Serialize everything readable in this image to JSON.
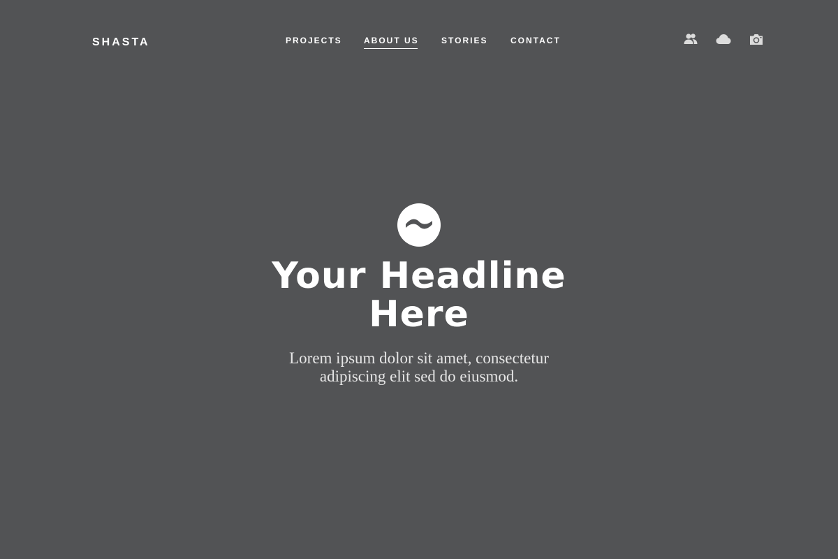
{
  "brand": {
    "name": "SHASTA"
  },
  "nav": {
    "items": [
      {
        "label": "PROJECTS",
        "active": false
      },
      {
        "label": "ABOUT US",
        "active": true
      },
      {
        "label": "STORIES",
        "active": false
      },
      {
        "label": "CONTACT",
        "active": false
      }
    ]
  },
  "header_icons": [
    "users-icon",
    "cloud-icon",
    "camera-icon"
  ],
  "hero": {
    "logo_icon": "wave-circle-logo",
    "headline": "Your Headline Here",
    "subtext": "Lorem ipsum dolor sit amet, consectetur adipiscing elit sed do eiusmod."
  },
  "colors": {
    "background": "#525355",
    "text": "#ffffff",
    "icon": "#dcdcdc"
  }
}
